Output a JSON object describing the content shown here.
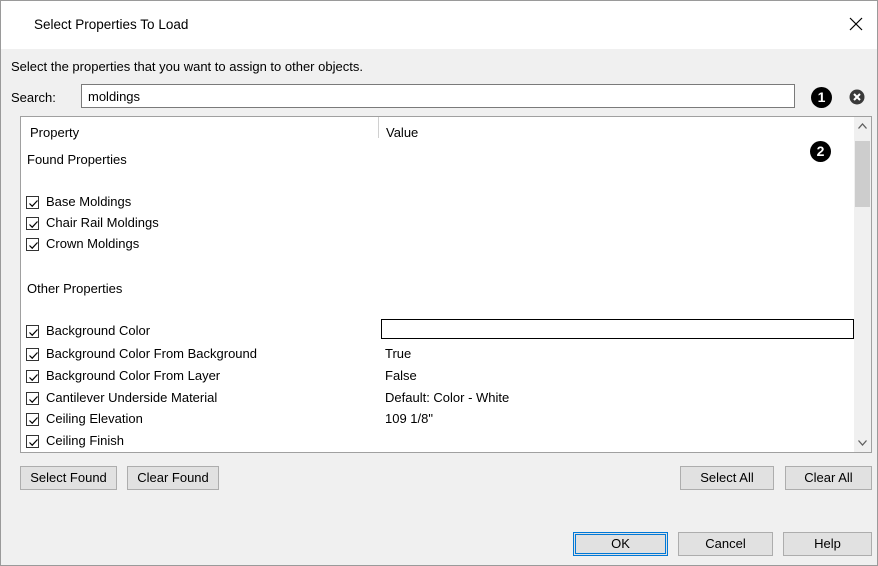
{
  "dialog": {
    "title": "Select Properties To Load",
    "instructions": "Select the properties that you want to assign to other objects.",
    "search_label": "Search:",
    "search_value": "moldings",
    "callouts": [
      "1",
      "2"
    ]
  },
  "grid": {
    "headers": {
      "property": "Property",
      "value": "Value"
    },
    "found_section": "Found Properties",
    "found_items": [
      {
        "label": "Base Moldings",
        "checked": true
      },
      {
        "label": "Chair Rail Moldings",
        "checked": true
      },
      {
        "label": "Crown Moldings",
        "checked": true
      }
    ],
    "other_section": "Other Properties",
    "other_items": [
      {
        "label": "Background Color",
        "value": "",
        "checked": true,
        "swatch_color": "#ffffff"
      },
      {
        "label": "Background Color From Background",
        "value": "True",
        "checked": true
      },
      {
        "label": "Background Color From Layer",
        "value": "False",
        "checked": true
      },
      {
        "label": "Cantilever Underside Material",
        "value": "Default: Color - White",
        "checked": true
      },
      {
        "label": "Ceiling Elevation",
        "value": "109 1/8\"",
        "checked": true
      },
      {
        "label": "Ceiling Finish",
        "value": "",
        "checked": true
      }
    ]
  },
  "buttons": {
    "select_found": "Select Found",
    "clear_found": "Clear Found",
    "select_all": "Select All",
    "clear_all": "Clear All",
    "ok": "OK",
    "cancel": "Cancel",
    "help": "Help"
  },
  "icons": {
    "close": "close-icon",
    "clear_search": "clear-search-icon",
    "checkbox": "checkmark-icon",
    "scroll_up": "chevron-up-icon",
    "scroll_down": "chevron-down-icon"
  }
}
